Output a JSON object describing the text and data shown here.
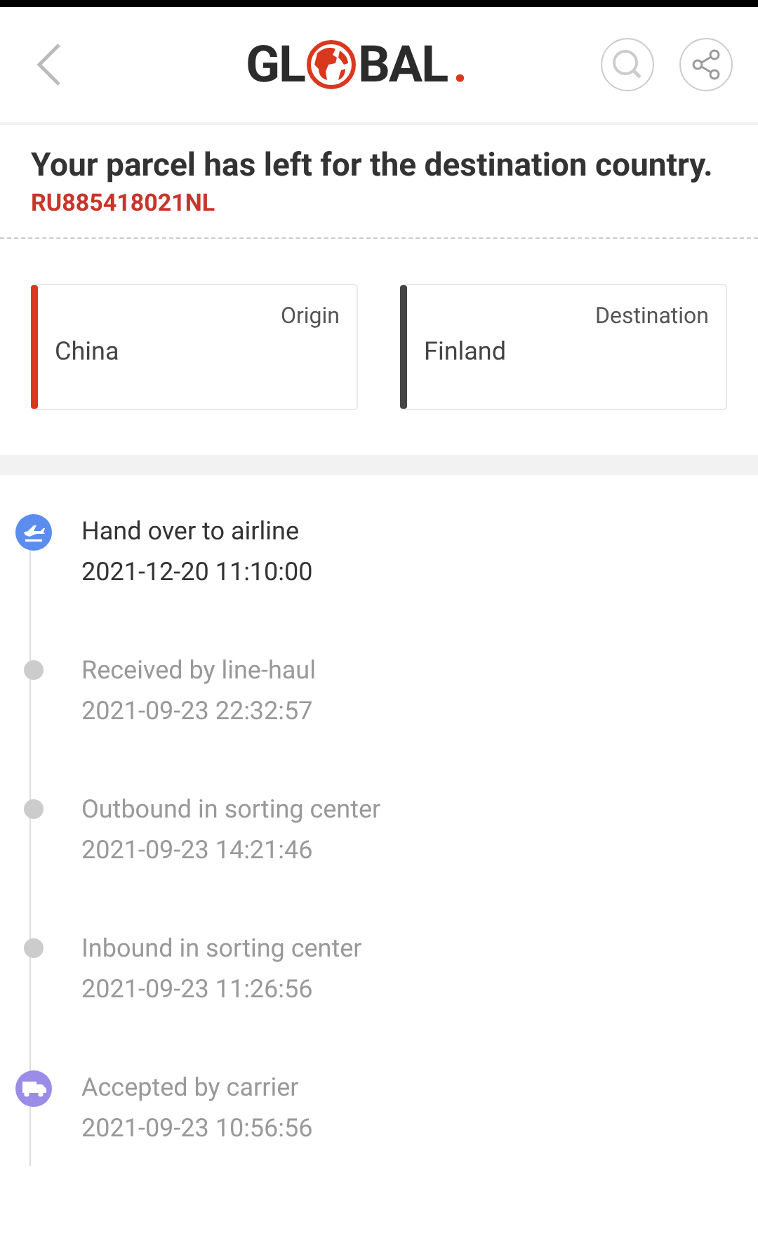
{
  "header": {
    "logo": {
      "before": "GL",
      "after": "BAL",
      "dot": "."
    }
  },
  "summary": {
    "status": "Your parcel has left for the destination country.",
    "tracking_number": "RU885418021NL",
    "places": [
      {
        "label": "Origin",
        "value": "China",
        "color": "#d9381e"
      },
      {
        "label": "Destination",
        "value": "Finland",
        "color": "#444444"
      }
    ]
  },
  "events": [
    {
      "kind": "plane",
      "current": true,
      "title": "Hand over to airline",
      "time": "2021-12-20 11:10:00"
    },
    {
      "kind": "dot",
      "current": false,
      "title": "Received by line-haul",
      "time": "2021-09-23 22:32:57"
    },
    {
      "kind": "dot",
      "current": false,
      "title": "Outbound in sorting center",
      "time": "2021-09-23 14:21:46"
    },
    {
      "kind": "dot",
      "current": false,
      "title": "Inbound in sorting center",
      "time": "2021-09-23 11:26:56"
    },
    {
      "kind": "truck",
      "current": false,
      "title": "Accepted by carrier",
      "time": "2021-09-23 10:56:56"
    }
  ]
}
